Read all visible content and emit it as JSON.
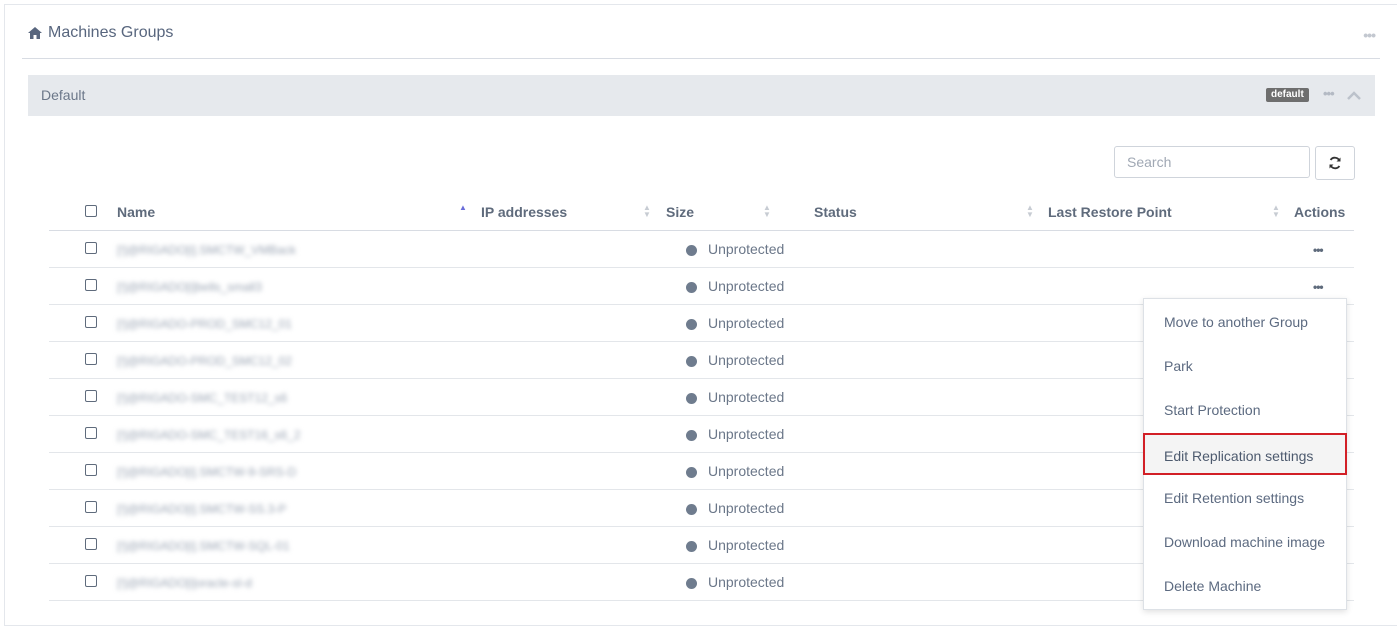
{
  "header": {
    "title": "Machines Groups",
    "home_icon": "home-icon",
    "more_icon": "ellipsis-icon"
  },
  "group": {
    "name": "Default",
    "badge": "default"
  },
  "toolbar": {
    "search_placeholder": "Search",
    "refresh_icon": "refresh-icon"
  },
  "table": {
    "columns": {
      "name": "Name",
      "ip": "IP addresses",
      "size": "Size",
      "status": "Status",
      "last_restore": "Last Restore Point",
      "actions": "Actions"
    },
    "sorted_column": "Name",
    "sort_direction": "ascending",
    "rows": [
      {
        "name": "[!]@RIGADO[i].SMCTW_VMBack",
        "ip": "",
        "size": "",
        "status": "Unprotected",
        "last_restore": ""
      },
      {
        "name": "[!]@RIGADO[i]bells_small3",
        "ip": "",
        "size": "",
        "status": "Unprotected",
        "last_restore": ""
      },
      {
        "name": "[!]@RIGADO-PROD_SMC12_01",
        "ip": "",
        "size": "",
        "status": "Unprotected",
        "last_restore": ""
      },
      {
        "name": "[!]@RIGADO-PROD_SMC12_02",
        "ip": "",
        "size": "",
        "status": "Unprotected",
        "last_restore": ""
      },
      {
        "name": "[!]@RIGADO-SMC_TEST12_s6",
        "ip": "",
        "size": "",
        "status": "Unprotected",
        "last_restore": ""
      },
      {
        "name": "[!]@RIGADO-SMC_TEST16_s6_2",
        "ip": "",
        "size": "",
        "status": "Unprotected",
        "last_restore": ""
      },
      {
        "name": "[!]@RIGADO[i].SMCTW-9-SRS-D",
        "ip": "",
        "size": "",
        "status": "Unprotected",
        "last_restore": ""
      },
      {
        "name": "[!]@RIGADO[i].SMCTW-SS.3-P",
        "ip": "",
        "size": "",
        "status": "Unprotected",
        "last_restore": ""
      },
      {
        "name": "[!]@RIGADO[i].SMCTW-SQL-01",
        "ip": "",
        "size": "",
        "status": "Unprotected",
        "last_restore": ""
      },
      {
        "name": "[!]@RIGADO[i]oracle-sl-d",
        "ip": "",
        "size": "",
        "status": "Unprotected",
        "last_restore": ""
      }
    ]
  },
  "context_menu": {
    "items": [
      {
        "label": "Move to another Group",
        "active": false
      },
      {
        "label": "Park",
        "active": false
      },
      {
        "label": "Start Protection",
        "active": false
      },
      {
        "label": "Edit Replication settings",
        "active": true
      },
      {
        "label": "Edit Retention settings",
        "active": false
      },
      {
        "label": "Download machine image",
        "active": false
      },
      {
        "label": "Delete Machine",
        "active": false
      }
    ]
  },
  "colors": {
    "status_unprotected": "#6f7c8e",
    "highlight_border": "#d21f26",
    "sort_active": "#6a6dd9"
  }
}
